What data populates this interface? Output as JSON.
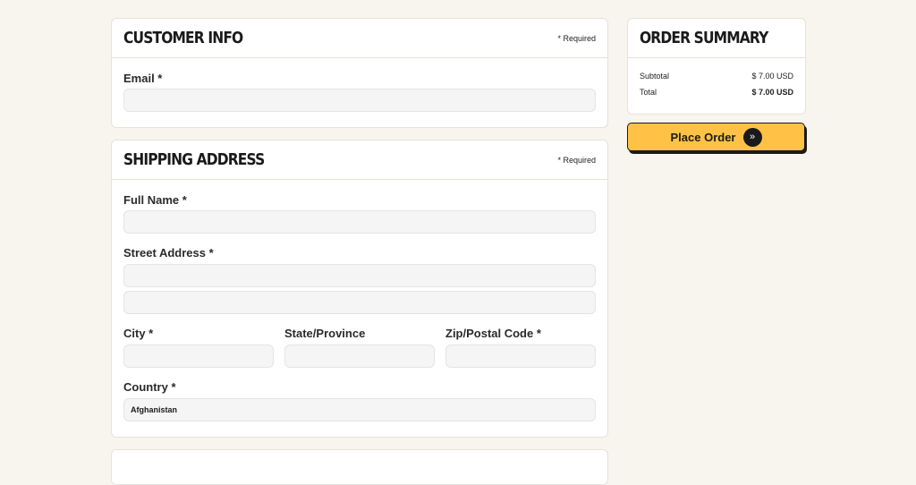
{
  "customer_info": {
    "title": "CUSTOMER INFO",
    "required_note": "* Required",
    "email_label": "Email *",
    "email_value": ""
  },
  "shipping": {
    "title": "SHIPPING ADDRESS",
    "required_note": "* Required",
    "full_name_label": "Full Name *",
    "street_label": "Street Address *",
    "city_label": "City *",
    "state_label": "State/Province",
    "zip_label": "Zip/Postal Code *",
    "country_label": "Country *",
    "country_value": "Afghanistan"
  },
  "summary": {
    "title": "ORDER SUMMARY",
    "subtotal_label": "Subtotal",
    "subtotal_value": "$ 7.00 USD",
    "total_label": "Total",
    "total_value": "$ 7.00 USD"
  },
  "place_order": {
    "label": "Place Order",
    "icon": "double-chevron-right-icon"
  },
  "colors": {
    "background": "#f8f4ee",
    "button": "#ffc247"
  }
}
